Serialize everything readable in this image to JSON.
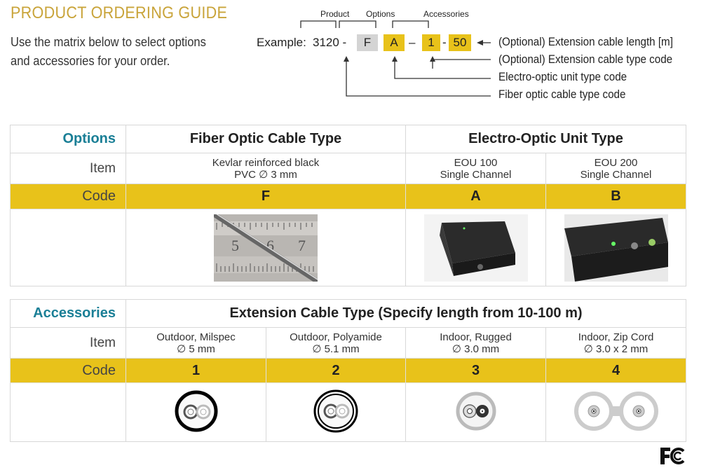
{
  "title": "PRODUCT ORDERING GUIDE",
  "intro": [
    "Use the matrix below to select options",
    "and accessories for your order."
  ],
  "example": {
    "label": "Example:",
    "product": "3120 -",
    "option1": "F",
    "option2": "A",
    "dash": "–",
    "acc1": "1",
    "sep": "-",
    "acc2": "50",
    "groups": {
      "product": "Product",
      "options": "Options",
      "accessories": "Accessories"
    },
    "notes": [
      "(Optional) Extension cable length [m]",
      "(Optional) Extension cable type code",
      "Electro-optic unit type code",
      "Fiber optic cable type code"
    ]
  },
  "options_table": {
    "section": "Options",
    "item_label": "Item",
    "code_label": "Code",
    "headers": [
      "Fiber Optic Cable Type",
      "Electro-Optic Unit Type"
    ],
    "columns": [
      {
        "item": [
          "Kevlar reinforced black",
          "PVC ∅ 3 mm"
        ],
        "code": "F",
        "image": "fiber-cable-photo"
      },
      {
        "item": [
          "EOU 100",
          "Single Channel"
        ],
        "code": "A",
        "image": "eou-100-photo"
      },
      {
        "item": [
          "EOU 200",
          "Single Channel"
        ],
        "code": "B",
        "image": "eou-200-photo"
      }
    ]
  },
  "accessories_table": {
    "section": "Accessories",
    "item_label": "Item",
    "code_label": "Code",
    "header": "Extension Cable Type (Specify length from 10-100 m)",
    "columns": [
      {
        "item": [
          "Outdoor, Milspec",
          "∅ 5 mm"
        ],
        "code": "1"
      },
      {
        "item": [
          "Outdoor, Polyamide",
          "∅ 5.1 mm"
        ],
        "code": "2"
      },
      {
        "item": [
          "Indoor, Rugged",
          "∅ 3.0 mm"
        ],
        "code": "3"
      },
      {
        "item": [
          "Indoor, Zip Cord",
          "∅ 3.0 x 2 mm"
        ],
        "code": "4"
      }
    ]
  },
  "logo": "FC",
  "colors": {
    "title": "#c9a43a",
    "section": "#1a7f96",
    "code_row": "#e8c21a",
    "option_gray": "#d4d4d4"
  }
}
